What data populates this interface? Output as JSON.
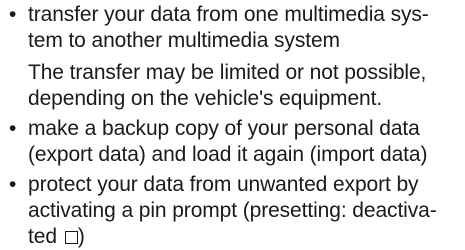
{
  "items": [
    {
      "lines": [
        "transfer your data from one multimedia sys-",
        "tem to another multimedia system"
      ],
      "note": [
        "The transfer may be limited or not possible,",
        "depending on the vehicle's equipment."
      ]
    },
    {
      "lines": [
        "make a backup copy of your personal data",
        "(export data) and load it again (import data)"
      ]
    },
    {
      "lines": [
        "protect your data from unwanted export by",
        "activating a pin prompt (presetting: deactiva-",
        "ted"
      ],
      "suffix": ")"
    }
  ],
  "bullet_glyph": "•",
  "icons": {
    "checkbox": "unchecked-checkbox-icon"
  }
}
